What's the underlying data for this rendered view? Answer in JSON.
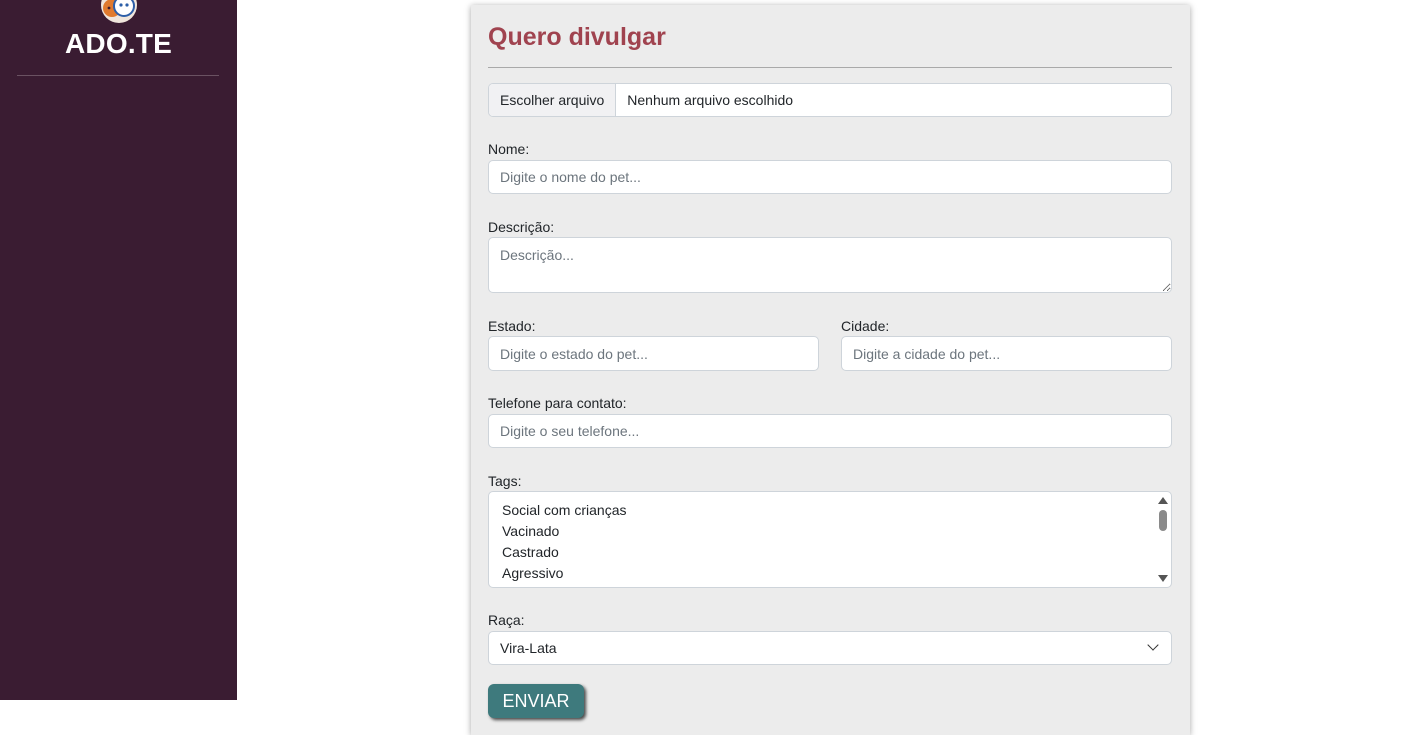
{
  "sidebar": {
    "brand": "ADO.TE"
  },
  "form": {
    "title": "Quero divulgar",
    "file": {
      "button_label": "Escolher arquivo",
      "status": "Nenhum arquivo escolhido"
    },
    "nome": {
      "label": "Nome:",
      "placeholder": "Digite o nome do pet..."
    },
    "descricao": {
      "label": "Descrição:",
      "placeholder": "Descrição..."
    },
    "estado": {
      "label": "Estado:",
      "placeholder": "Digite o estado do pet..."
    },
    "cidade": {
      "label": "Cidade:",
      "placeholder": "Digite a cidade do pet..."
    },
    "telefone": {
      "label": "Telefone para contato:",
      "placeholder": "Digite o seu telefone..."
    },
    "tags": {
      "label": "Tags:",
      "options": [
        "Social com crianças",
        "Vacinado",
        "Castrado",
        "Agressivo"
      ]
    },
    "raca": {
      "label": "Raça:",
      "selected": "Vira-Lata"
    },
    "submit_label": "ENVIAR"
  },
  "colors": {
    "sidebar_bg": "#3a1c32",
    "title_accent": "#a0434f",
    "button_bg": "#3e7a7d",
    "card_bg": "#ececec"
  },
  "icons": {
    "logo": "pets-logo",
    "select_arrow": "chevron-down-icon"
  }
}
